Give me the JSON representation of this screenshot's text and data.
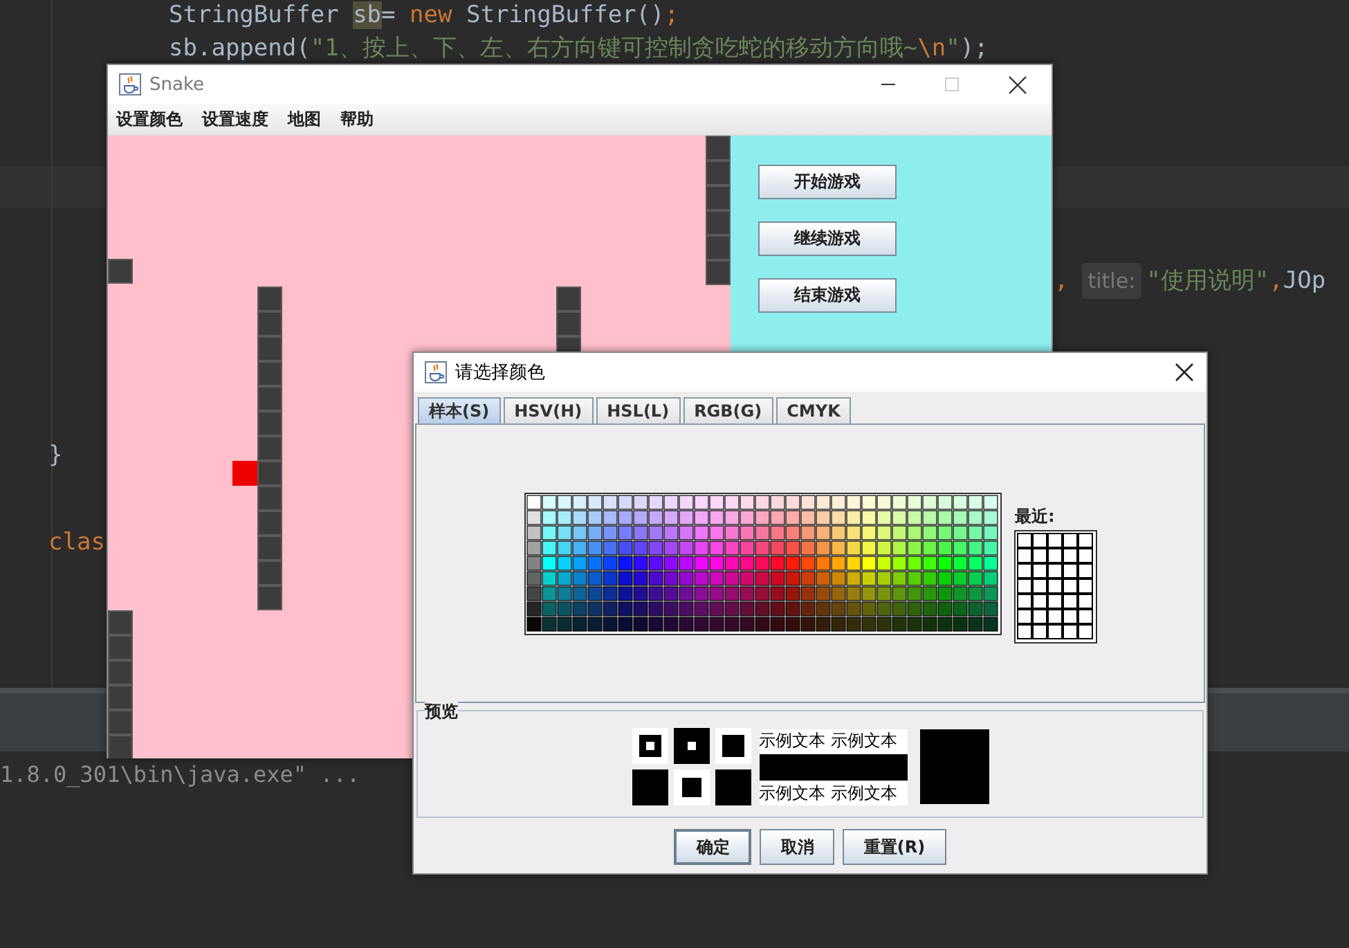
{
  "editor": {
    "lines": [
      {
        "segments": [
          {
            "kind": "plain",
            "text": "StringBuffer "
          },
          {
            "kind": "highlight",
            "text": "sb"
          },
          {
            "kind": "plain",
            "text": "= "
          },
          {
            "kind": "keyword",
            "text": "new"
          },
          {
            "kind": "plain",
            "text": " StringBuffer()"
          },
          {
            "kind": "keyword",
            "text": ";"
          }
        ]
      },
      {
        "segments": [
          {
            "kind": "plain",
            "text": "sb.append("
          },
          {
            "kind": "string",
            "text": "\"1、按上、下、左、右方向键可控制贪吃蛇的移动方向哦~"
          },
          {
            "kind": "keyword",
            "text": "\\n"
          },
          {
            "kind": "string",
            "text": "\""
          },
          {
            "kind": "plain",
            "text": ");"
          }
        ]
      },
      {
        "segments": [
          {
            "kind": "keyword",
            "text": ","
          },
          {
            "kind": "hint",
            "text": "title:"
          },
          {
            "kind": "string",
            "text": "\"使用说明\""
          },
          {
            "kind": "keyword",
            "text": ","
          },
          {
            "kind": "plain",
            "text": "JOp"
          }
        ]
      },
      {
        "segments": [
          {
            "kind": "plain",
            "text": "}"
          }
        ]
      },
      {
        "segments": [
          {
            "kind": "keyword",
            "text": "clas"
          }
        ]
      }
    ],
    "console_line": "1.8.0_301\\bin\\java.exe\" ..."
  },
  "snake_window": {
    "title": "Snake",
    "menu": [
      "设置颜色",
      "设置速度",
      "地图",
      "帮助"
    ],
    "buttons": [
      "开始游戏",
      "继续游戏",
      "结束游戏"
    ]
  },
  "color_dialog": {
    "title": "请选择颜色",
    "tabs": [
      {
        "label": "样本(S)",
        "selected": true
      },
      {
        "label": "HSV(H)",
        "selected": false
      },
      {
        "label": "HSL(L)",
        "selected": false
      },
      {
        "label": "RGB(G)",
        "selected": false
      },
      {
        "label": "CMYK",
        "selected": false
      }
    ],
    "recent_label": "最近:",
    "preview_label": "预览",
    "sample_texts": [
      "示例文本",
      "示例文本",
      "示例文本",
      "示例文本"
    ],
    "buttons": [
      {
        "label": "确定",
        "default": true
      },
      {
        "label": "取消",
        "default": false
      },
      {
        "label": "重置(R)",
        "default": false
      }
    ]
  }
}
